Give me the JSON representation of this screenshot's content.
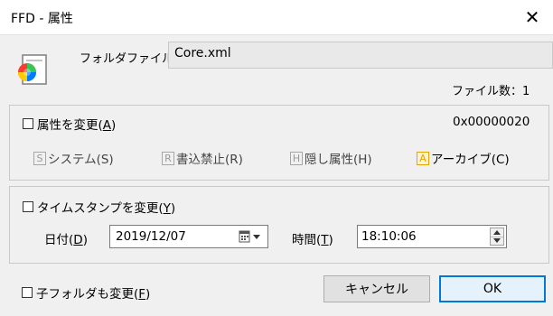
{
  "window": {
    "title": "FFD - 属性",
    "close_glyph": "✕"
  },
  "folder": {
    "label": "フォルダファイル",
    "value": "Core.xml"
  },
  "file_count": {
    "text": "ファイル数：1"
  },
  "attributes": {
    "checkbox_label": "属性を変更(",
    "checkbox_mnemonic": "A",
    "checkbox_suffix": ")",
    "checked": false,
    "value": "0x00000020",
    "items": [
      {
        "key": "S",
        "label": "システム(S)",
        "active": false
      },
      {
        "key": "R",
        "label": "書込禁止(R)",
        "active": false
      },
      {
        "key": "H",
        "label": "隠し属性(H)",
        "active": false
      },
      {
        "key": "A",
        "label": "アーカイブ(C)",
        "active": true
      }
    ]
  },
  "timestamp": {
    "checkbox_label": "タイムスタンプを変更(",
    "checkbox_mnemonic": "Y",
    "checkbox_suffix": ")",
    "checked": false,
    "date_label": "日付(",
    "date_mnemonic": "D",
    "date_suffix": ")",
    "date_value": "2019/12/07",
    "time_label": "時間(",
    "time_mnemonic": "T",
    "time_suffix": ")",
    "time_value": "18:10:06"
  },
  "subfolder": {
    "checkbox_label": "子フォルダも変更(",
    "checkbox_mnemonic": "F",
    "checkbox_suffix": ")",
    "checked": false
  },
  "buttons": {
    "cancel": "キャンセル",
    "ok": "OK"
  },
  "colors": {
    "accent": "#0078d7",
    "archive_key": "#e6a400"
  }
}
